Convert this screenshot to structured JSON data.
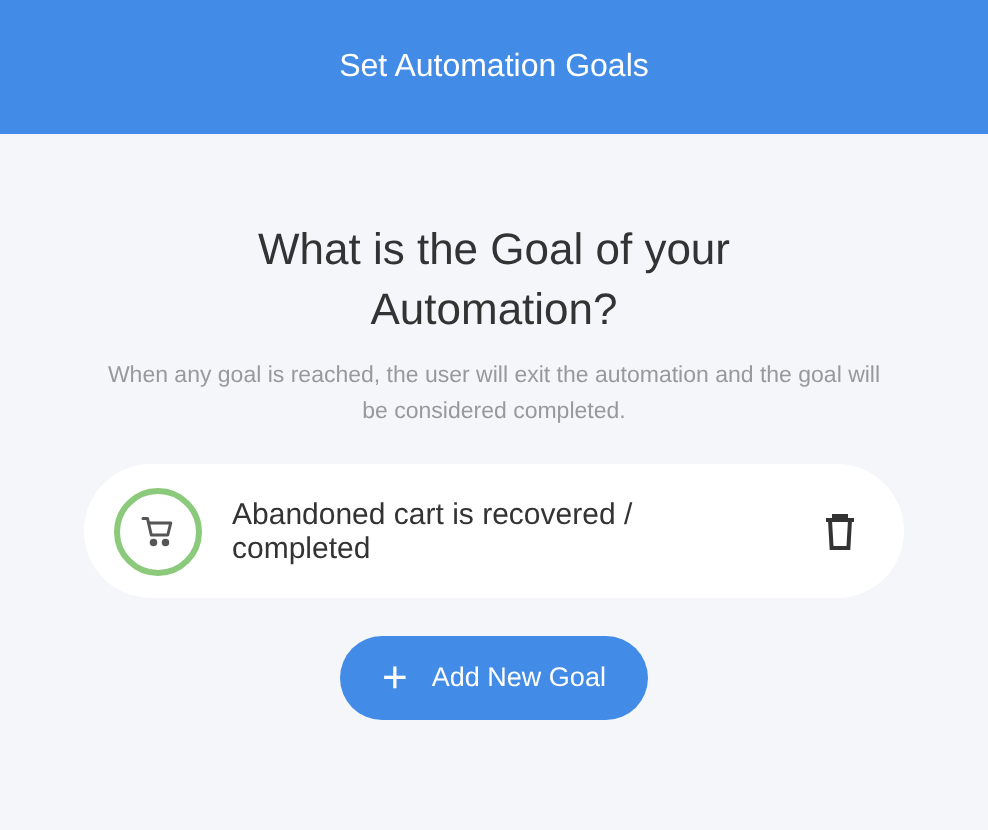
{
  "header": {
    "title": "Set Automation Goals"
  },
  "heading": "What is the Goal of your Automation?",
  "description": "When any goal is reached, the user will exit the automation and the goal will be considered completed.",
  "goals": [
    {
      "label": "Abandoned cart is recovered / completed"
    }
  ],
  "add_button": {
    "icon": "+",
    "label": "Add New Goal"
  }
}
